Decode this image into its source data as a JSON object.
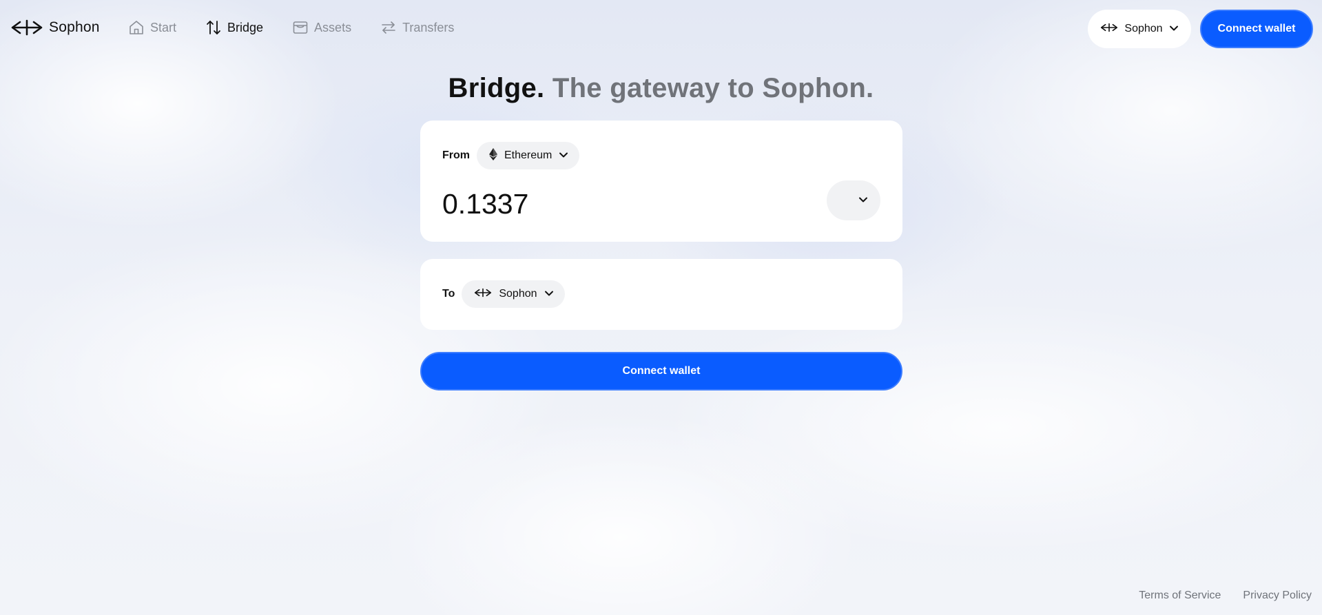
{
  "brand": {
    "name": "Sophon",
    "icon": "sophon-logo-icon"
  },
  "nav": [
    {
      "label": "Start",
      "icon": "home-icon",
      "active": false
    },
    {
      "label": "Bridge",
      "icon": "swap-vertical-icon",
      "active": true
    },
    {
      "label": "Assets",
      "icon": "wallet-icon",
      "active": false
    },
    {
      "label": "Transfers",
      "icon": "arrows-left-right-icon",
      "active": false
    }
  ],
  "network_selector": {
    "label": "Sophon"
  },
  "header_connect": {
    "label": "Connect wallet"
  },
  "title": {
    "bold": "Bridge.",
    "rest": "The gateway to Sophon."
  },
  "from": {
    "label": "From",
    "chain": "Ethereum",
    "amount": "0.1337"
  },
  "to": {
    "label": "To",
    "chain": "Sophon"
  },
  "main_connect": {
    "label": "Connect wallet"
  },
  "footer": {
    "terms": "Terms of Service",
    "privacy": "Privacy Policy"
  },
  "colors": {
    "accent": "#0a5cff",
    "muted": "#8a8e96",
    "card": "#ffffff"
  }
}
